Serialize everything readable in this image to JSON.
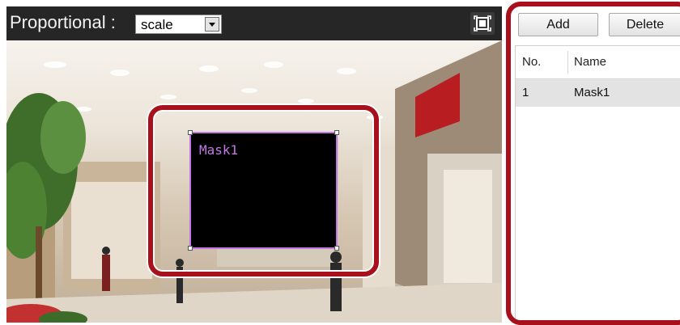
{
  "toolbar": {
    "proportional_label": "Proportional :",
    "scale_value": "scale"
  },
  "mask": {
    "label": "Mask1"
  },
  "buttons": {
    "add": "Add",
    "delete": "Delete"
  },
  "table": {
    "headers": [
      "No.",
      "Name"
    ],
    "rows": [
      {
        "no": "1",
        "name": "Mask1"
      }
    ]
  },
  "colors": {
    "highlight": "#a8101b",
    "mask_border": "#c478e6",
    "toolbar_bg": "#262626",
    "selected_row": "#e3e3e3"
  },
  "icons": [
    "dropdown-arrow-icon",
    "fullscreen-icon"
  ]
}
